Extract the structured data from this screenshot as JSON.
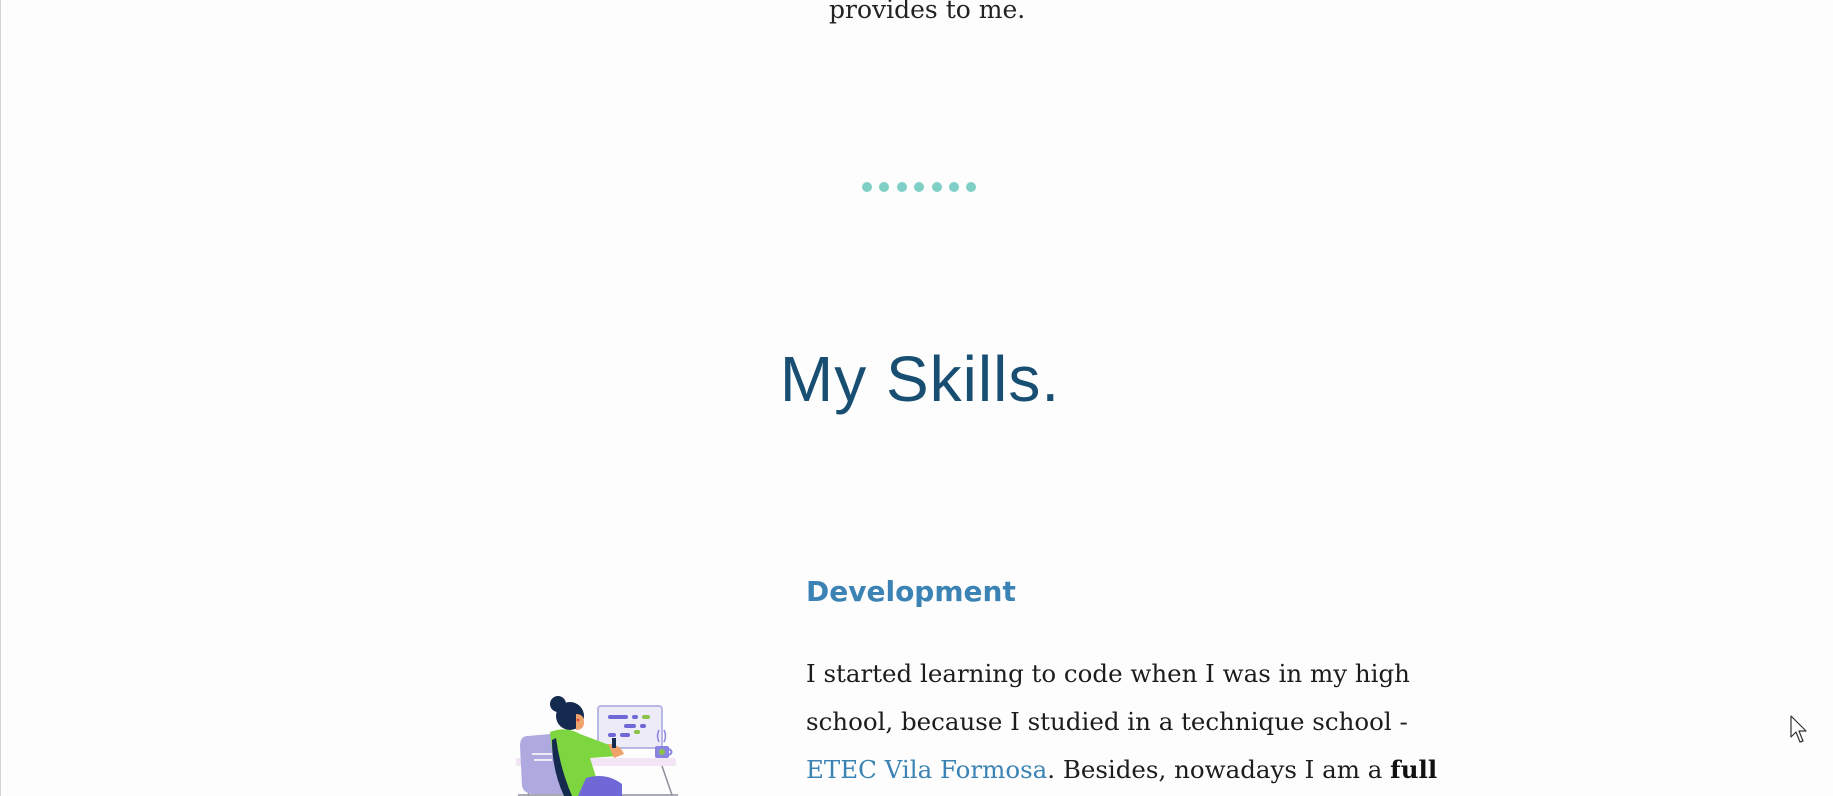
{
  "intro": {
    "tail_text": "provides to me."
  },
  "divider": {
    "dots": [
      1,
      2,
      3,
      4,
      5,
      6,
      7
    ],
    "color": "#7fcfc6"
  },
  "skills": {
    "heading": "My Skills.",
    "development": {
      "title": "Development",
      "line1": "I started learning to code when I was in my high",
      "line2": "school, because I studied in a technique school -",
      "link_text": "ETEC Vila Formosa",
      "line3_rest": ". Besides, nowadays I am a ",
      "line3_bold": "full",
      "illustration": "developer-at-desk-illustration"
    }
  },
  "colors": {
    "heading": "#184e72",
    "accent": "#3a83b4",
    "text": "#1c1c1c",
    "background": "#fdfdfd"
  }
}
